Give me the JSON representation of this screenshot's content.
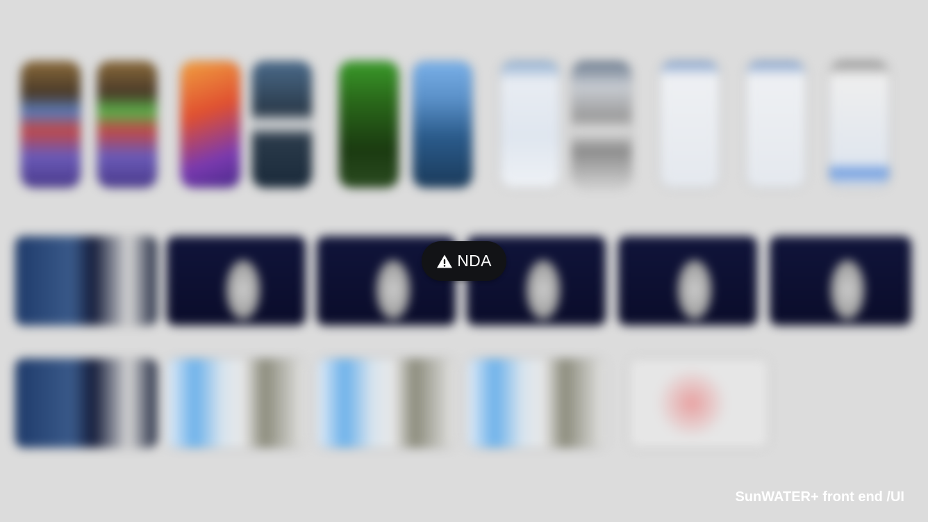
{
  "badge": {
    "label": "NDA",
    "icon": "warning-icon",
    "background": "#121316"
  },
  "caption": {
    "text": "SunWATER+ front end /UI"
  },
  "gallery": {
    "blurred": true,
    "background": "#dcdcdc"
  }
}
